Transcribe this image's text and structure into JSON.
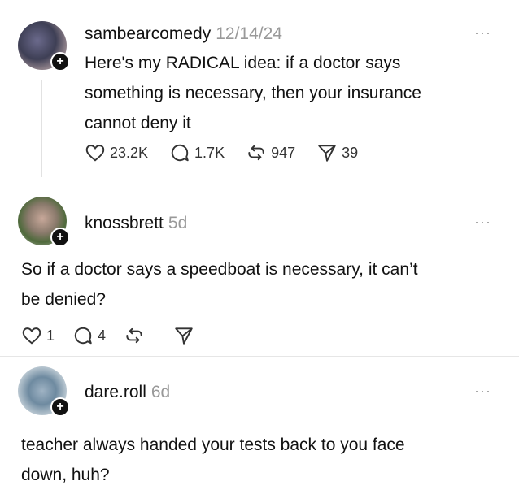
{
  "posts": [
    {
      "username": "sambearcomedy",
      "time": "12/14/24",
      "more": "···",
      "lines": [
        "Here's my RADICAL idea: if a doctor says",
        "something is necessary, then your  insurance",
        "cannot deny it"
      ],
      "likes": "23.2K",
      "replies": "1.7K",
      "reposts": "947",
      "shares": "39"
    },
    {
      "username": "knossbrett",
      "time": "5d",
      "more": "···",
      "lines": [
        "So if a doctor says a speedboat is necessary, it can’t",
        "be denied?"
      ],
      "likes": "1",
      "replies": "4",
      "reposts": "",
      "shares": ""
    },
    {
      "username": "dare.roll",
      "time": "6d",
      "more": "···",
      "lines": [
        "teacher always handed your tests back to you face",
        "down, huh?"
      ]
    }
  ],
  "icons": {
    "like": "heart-icon",
    "reply": "comment-icon",
    "repost": "repost-icon",
    "share": "send-icon",
    "follow": "plus-icon"
  },
  "colors": {
    "text": "#111111",
    "muted": "#999999",
    "divider": "#e6e6e6"
  }
}
